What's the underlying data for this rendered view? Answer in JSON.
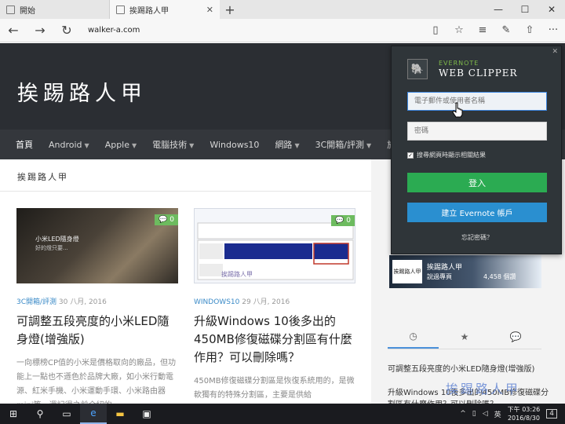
{
  "tabs": [
    {
      "label": "開始",
      "active": false
    },
    {
      "label": "挨踢路人甲",
      "active": true
    }
  ],
  "window_controls": {
    "minimize": "—",
    "maximize": "☐",
    "close": "✕"
  },
  "address": {
    "url": "walker-a.com"
  },
  "site": {
    "title": "挨踢路人甲",
    "nav": [
      "首頁",
      "Android",
      "Apple",
      "電腦技術",
      "Windows10",
      "網路",
      "3C開箱/評測",
      "旅"
    ],
    "breadcrumb": "挨踢路人甲"
  },
  "posts": [
    {
      "thumb_caption": "小米LED隨身燈",
      "thumb_caption2": "好的燈只要...",
      "comments": "0",
      "category": "3C開箱/評測",
      "date": "30 八月, 2016",
      "title": "可調整五段亮度的小米LED隨身燈(增強版)",
      "excerpt": "一向標榜CP值的小米是價格取向的廠品，但功能上一點也不遜色於品牌大廠，如小米行動電源、紅米手機、小米運動手環、小米路由器mini等，還記得之前介紹的"
    },
    {
      "thumb_caption": "挨踢路人甲",
      "thumb_caption2": "",
      "comments": "0",
      "category": "WINDOWS10",
      "date": "29 八月, 2016",
      "title": "升級Windows 10後多出的450MB修復磁碟分割區有什麼作用？可以刪除嗎？",
      "excerpt": "450MB修復磁碟分割區是恢復系統用的，是微軟獨有的特殊分割區，主要是供給"
    }
  ],
  "sidebar": {
    "banner_name": "挨踢路人甲",
    "banner_line1": "挨踢路人甲",
    "banner_line2": "說過專頁",
    "banner_likes": "4,458 個讚",
    "tabs": [
      "◷",
      "★",
      "💬"
    ],
    "links": [
      "可調整五段亮度的小米LED隨身燈(增強版)",
      "升級Windows 10後多出的450MB修復磁碟分割區有什麼作用？可以刪除嗎？"
    ]
  },
  "watermark": "挨踢路人甲",
  "clipper": {
    "brand": "EVERNOTE",
    "name": "WEB CLIPPER",
    "email_placeholder": "電子郵件或使用者名稱",
    "password_placeholder": "密碼",
    "checkbox_label": "搜尋網頁時顯示相關結果",
    "checkbox_checked": true,
    "login_label": "登入",
    "create_label": "建立 Evernote 帳戶",
    "forgot_label": "忘記密碼？"
  },
  "taskbar": {
    "time": "下午 03:26",
    "date": "2016/8/30",
    "notifications": "4"
  },
  "colors": {
    "header": "#2b2e33",
    "nav": "#34373c",
    "clipper_bg": "#2f3539",
    "login_green": "#2bab52",
    "create_blue": "#2a8fd0",
    "category_blue": "#3a8ac7",
    "comment_green": "#6dbb5f"
  }
}
